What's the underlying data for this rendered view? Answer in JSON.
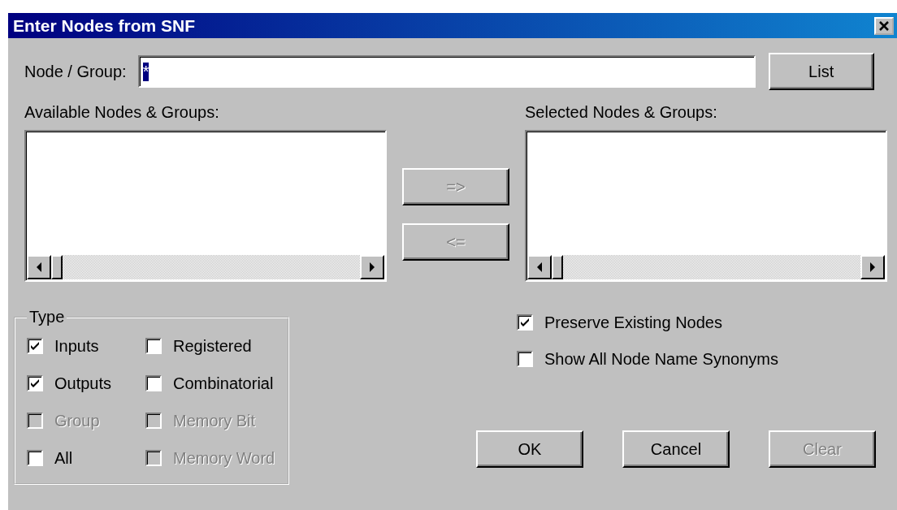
{
  "window": {
    "title": "Enter Nodes from SNF"
  },
  "node_group": {
    "label": "Node / Group:",
    "value": "*",
    "value_selected": true
  },
  "list_button": {
    "label": "List",
    "disabled": false
  },
  "available": {
    "label": "Available Nodes & Groups:"
  },
  "selected": {
    "label": "Selected Nodes & Groups:"
  },
  "transfer_buttons": [
    {
      "label": "=>",
      "disabled": true
    },
    {
      "label": "<=",
      "disabled": true
    }
  ],
  "type_group": {
    "title": "Type",
    "options": [
      {
        "label": "Inputs",
        "checked": true,
        "disabled": false
      },
      {
        "label": "Registered",
        "checked": false,
        "disabled": false
      },
      {
        "label": "Outputs",
        "checked": true,
        "disabled": false
      },
      {
        "label": "Combinatorial",
        "checked": false,
        "disabled": false
      },
      {
        "label": "Group",
        "checked": false,
        "disabled": true
      },
      {
        "label": "Memory Bit",
        "checked": false,
        "disabled": true
      },
      {
        "label": "All",
        "checked": false,
        "disabled": false
      },
      {
        "label": "Memory Word",
        "checked": false,
        "disabled": true
      }
    ]
  },
  "options": [
    {
      "label": "Preserve Existing Nodes",
      "checked": true,
      "disabled": false
    },
    {
      "label": "Show All Node Name Synonyms",
      "checked": false,
      "disabled": false
    }
  ],
  "buttons": [
    {
      "label": "OK",
      "disabled": false
    },
    {
      "label": "Cancel",
      "disabled": false
    },
    {
      "label": "Clear",
      "disabled": true
    }
  ]
}
